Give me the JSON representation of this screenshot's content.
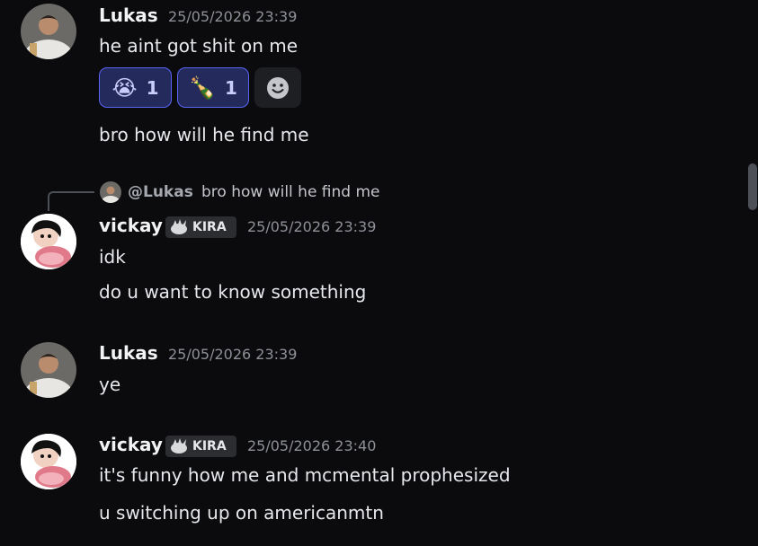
{
  "messages": [
    {
      "author": "Lukas",
      "timestamp": "25/05/2026 23:39",
      "lines": [
        "he aint got shit on me",
        "bro how will he find me"
      ],
      "reactions": [
        {
          "emoji": "😭",
          "count": "1"
        },
        {
          "emoji": "🍾",
          "count": "1"
        }
      ]
    },
    {
      "reply": {
        "mention": "@Lukas",
        "text": "bro how will he find me"
      },
      "author": "vickay",
      "tag": "KIRA",
      "timestamp": "25/05/2026 23:39",
      "lines": [
        "idk",
        "do u want to know something"
      ]
    },
    {
      "author": "Lukas",
      "timestamp": "25/05/2026 23:39",
      "lines": [
        "ye"
      ]
    },
    {
      "author": "vickay",
      "tag": "KIRA",
      "timestamp": "25/05/2026 23:40",
      "lines": [
        "it's funny how me and mcmental prophesized",
        "u switching up on americanmtn"
      ]
    }
  ],
  "icons": {
    "add_reaction": "add-reaction-smiley-icon",
    "tag_icon": "kira-tag-icon"
  },
  "colors": {
    "background": "#0b0b0e",
    "reaction_border": "#5865f2",
    "reaction_bg": "#242a5c",
    "timestamp": "#8d9097"
  }
}
